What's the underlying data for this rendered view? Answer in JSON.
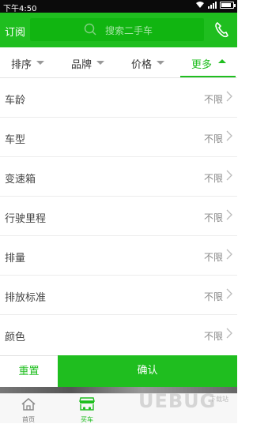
{
  "status_bar": {
    "time": "下午4:50"
  },
  "header": {
    "subscribe_label": "订阅",
    "search_placeholder": "搜索二手车",
    "icons": [
      "search-icon",
      "phone-icon"
    ]
  },
  "tabs": [
    {
      "label": "排序",
      "active": false
    },
    {
      "label": "品牌",
      "active": false
    },
    {
      "label": "价格",
      "active": false
    },
    {
      "label": "更多",
      "active": true
    }
  ],
  "filters": [
    {
      "label": "车龄",
      "value": "不限"
    },
    {
      "label": "车型",
      "value": "不限"
    },
    {
      "label": "变速箱",
      "value": "不限"
    },
    {
      "label": "行驶里程",
      "value": "不限"
    },
    {
      "label": "排量",
      "value": "不限"
    },
    {
      "label": "排放标准",
      "value": "不限"
    },
    {
      "label": "颜色",
      "value": "不限"
    }
  ],
  "actions": {
    "reset_label": "重置",
    "confirm_label": "确认"
  },
  "bottom_nav": [
    {
      "label": "首页",
      "icon": "home-icon",
      "active": false
    },
    {
      "label": "买车",
      "icon": "car-market-icon",
      "active": true
    }
  ],
  "watermark": {
    "main": "UEBUG",
    "sub": "下载站"
  },
  "colors": {
    "accent": "#1fbe1f",
    "statusbar": "#0b0b0b"
  }
}
